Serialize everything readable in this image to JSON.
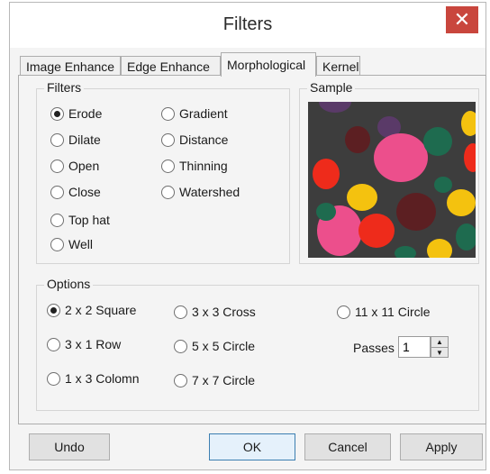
{
  "window": {
    "title": "Filters"
  },
  "tabs": [
    {
      "label": "Image Enhance",
      "active": false
    },
    {
      "label": "Edge Enhance",
      "active": false
    },
    {
      "label": "Morphological",
      "active": true
    },
    {
      "label": "Kernel",
      "active": false
    }
  ],
  "filters_group": {
    "label": "Filters",
    "selected": "Erode",
    "options": [
      "Erode",
      "Dilate",
      "Open",
      "Close",
      "Top hat",
      "Well",
      "Gradient",
      "Distance",
      "Thinning",
      "Watershed"
    ]
  },
  "sample_group": {
    "label": "Sample"
  },
  "options_group": {
    "label": "Options",
    "selected": "2 x 2 Square",
    "options": [
      "2 x 2 Square",
      "3 x 1 Row",
      "1 x 3 Colomn",
      "3 x 3 Cross",
      "5 x 5 Circle",
      "7 x 7 Circle",
      "11 x 11 Circle"
    ],
    "passes_label": "Passes",
    "passes_value": "1"
  },
  "buttons": {
    "undo": "Undo",
    "ok": "OK",
    "cancel": "Cancel",
    "apply": "Apply"
  },
  "colors": {
    "close_button": "#c9463d",
    "sample_background": "#3d3d3d",
    "blob_pink": "#ec4f8c",
    "blob_red": "#ee2b1b",
    "blob_yellow": "#f4c20f",
    "blob_green": "#1e6b4f",
    "blob_purple": "#5a3a68",
    "blob_maroon": "#5c1f22"
  }
}
